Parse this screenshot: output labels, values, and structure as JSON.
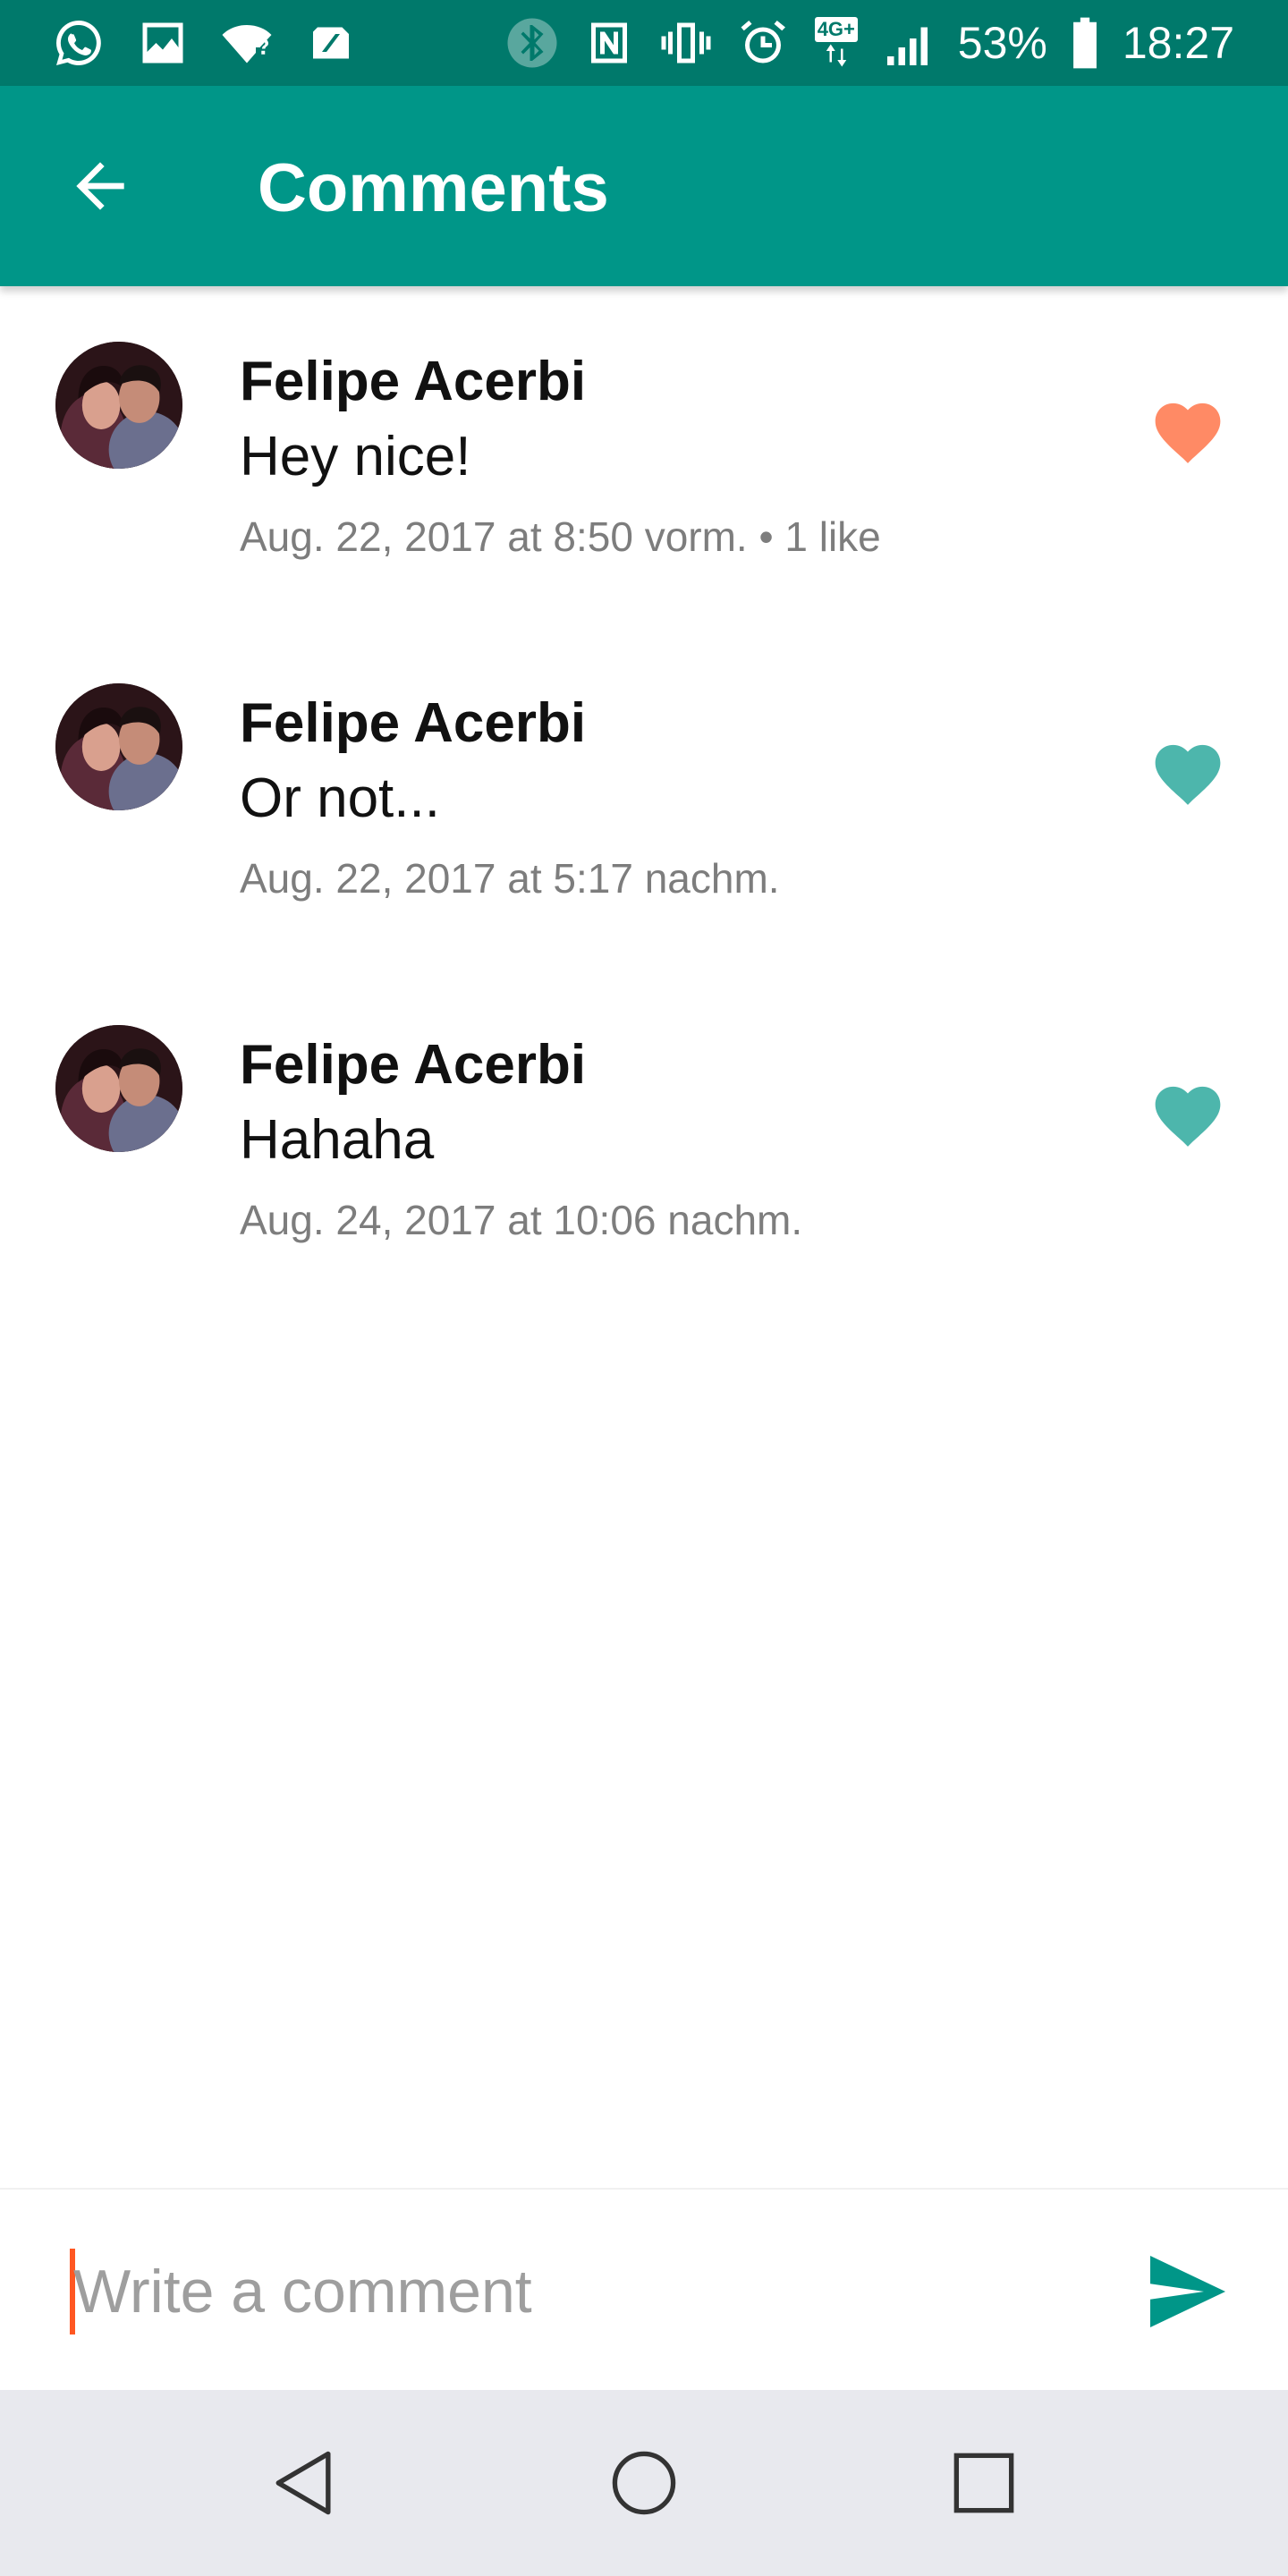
{
  "status_bar": {
    "battery_percent": "53%",
    "time": "18:27",
    "network_badge": "4G+",
    "icons_left": [
      "whatsapp-icon",
      "image-icon",
      "wifi-question-icon",
      "sim-icon"
    ],
    "icons_right": [
      "bluetooth-icon",
      "nfc-icon",
      "vibrate-icon",
      "alarm-icon",
      "network-4g-icon",
      "signal-icon",
      "battery-icon"
    ]
  },
  "app_bar": {
    "title": "Comments",
    "background": "#009688"
  },
  "comments": [
    {
      "author": "Felipe Acerbi",
      "text": "Hey nice!",
      "meta": "Aug. 22, 2017 at 8:50 vorm. • 1 like",
      "liked": true,
      "heart_color": "#FF8A65"
    },
    {
      "author": "Felipe Acerbi",
      "text": "Or not...",
      "meta": "Aug. 22, 2017 at 5:17 nachm.",
      "liked": false,
      "heart_color": "#4DB6AC"
    },
    {
      "author": "Felipe Acerbi",
      "text": "Hahaha",
      "meta": "Aug. 24, 2017 at 10:06 nachm.",
      "liked": false,
      "heart_color": "#4DB6AC"
    }
  ],
  "composer": {
    "placeholder": "Write a comment",
    "value": "",
    "send_color": "#009688",
    "caret_color": "#FF5722"
  },
  "nav_bar": {
    "buttons": [
      "back-triangle-icon",
      "home-circle-icon",
      "recents-square-icon"
    ]
  }
}
